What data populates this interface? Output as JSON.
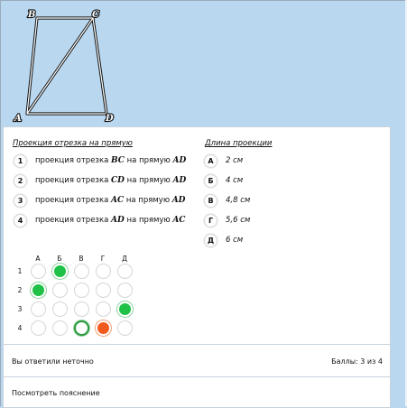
{
  "figure": {
    "labels": {
      "a": "A",
      "b": "B",
      "c": "C",
      "d": "D"
    }
  },
  "left_header": "Проекция отрезка на прямую",
  "right_header": "Длина проекции",
  "questions": [
    {
      "num": "1",
      "pre": "проекция отрезка ",
      "seg": "BC",
      "mid": " на прямую ",
      "line": "AD"
    },
    {
      "num": "2",
      "pre": "проекция отрезка ",
      "seg": "CD",
      "mid": " на прямую ",
      "line": "AD"
    },
    {
      "num": "3",
      "pre": "проекция отрезка ",
      "seg": "AC",
      "mid": " на прямую ",
      "line": "AD"
    },
    {
      "num": "4",
      "pre": "проекция отрезка ",
      "seg": "AD",
      "mid": " на прямую ",
      "line": "AC"
    }
  ],
  "answers": [
    {
      "letter": "А",
      "value": "2 см"
    },
    {
      "letter": "Б",
      "value": "4 см"
    },
    {
      "letter": "В",
      "value": "4,8 см"
    },
    {
      "letter": "Г",
      "value": "5,6 см"
    },
    {
      "letter": "Д",
      "value": "6 см"
    }
  ],
  "grid": {
    "cols": [
      "А",
      "Б",
      "В",
      "Г",
      "Д"
    ],
    "rows": [
      "1",
      "2",
      "3",
      "4"
    ]
  },
  "status": "Вы ответили неточно",
  "score": "Баллы: 3 из 4",
  "explain_link": "Посмотреть пояснение"
}
